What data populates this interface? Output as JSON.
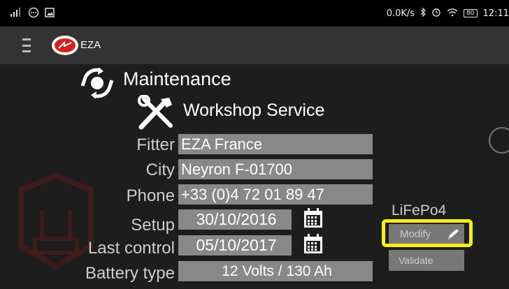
{
  "status_bar": {
    "network_speed": "0.0K/s",
    "battery_level": "80",
    "time": "12:11"
  },
  "app_bar": {
    "title": "EZA"
  },
  "maintenance": {
    "title": "Maintenance"
  },
  "workshop": {
    "title": "Workshop Service",
    "fields": [
      {
        "label": "Fitter",
        "value": "EZA France"
      },
      {
        "label": "City",
        "value": "Neyron F-01700"
      },
      {
        "label": "Phone",
        "value": "+33 (0)4 72 01 89 47"
      },
      {
        "label": "Setup",
        "value": "30/10/2016"
      },
      {
        "label": "Last control",
        "value": "05/10/2017"
      },
      {
        "label": "Battery type",
        "value": "12 Volts / 130 Ah"
      }
    ]
  },
  "battery_chemistry": "LiFePo4",
  "actions": {
    "modify_label": "Modify",
    "validate_label": "Validate"
  },
  "colors": {
    "highlight": "#f5ef12",
    "brand_red": "#d61f1f",
    "field_bg": "#888888"
  }
}
